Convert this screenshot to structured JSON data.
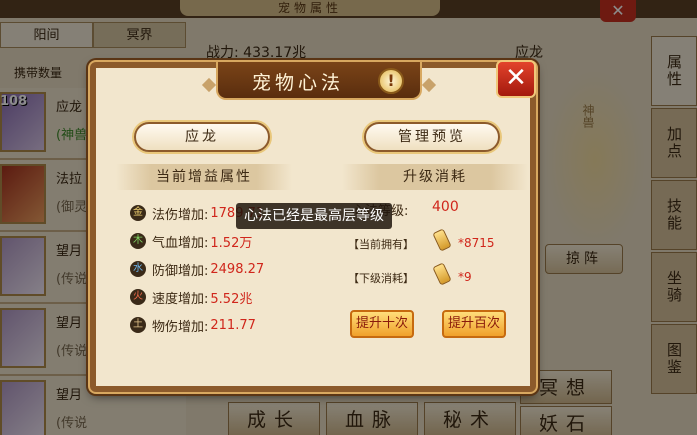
{
  "background": {
    "panel_title": "宠物属性",
    "tabs": [
      "阳间",
      "冥界"
    ],
    "carry_label": "携带数量",
    "pets": [
      {
        "level": "108",
        "name": "应龙",
        "sub": "(神兽"
      },
      {
        "level": "",
        "name": "法拉",
        "sub": "(御灵"
      },
      {
        "level": "",
        "name": "望月",
        "sub": "(传说"
      },
      {
        "level": "",
        "name": "望月",
        "sub": "(传说"
      },
      {
        "level": "",
        "name": "望月",
        "sub": "(传说"
      }
    ],
    "power_label": "战力:",
    "power_value": "433.17兆",
    "pet_name": "应龙",
    "hero_label": "神兽",
    "side_tabs": [
      "属性",
      "加点",
      "技能",
      "坐骑",
      "图鉴"
    ],
    "lineup_button": "掠阵",
    "bottom_buttons": [
      "成长",
      "血脉",
      "秘术",
      "冥想",
      "妖石"
    ]
  },
  "dialog": {
    "title": "宠物心法",
    "info_icon": "!",
    "close_icon": "✕",
    "pet_button": "应龙",
    "manage_button": "管理预览",
    "left_section": "当前增益属性",
    "right_section": "升级消耗",
    "attributes": [
      {
        "element": "金",
        "label": "法伤增加:",
        "value": "1789.71"
      },
      {
        "element": "木",
        "label": "气血增加:",
        "value": "1.52万"
      },
      {
        "element": "水",
        "label": "防御增加:",
        "value": "2498.27"
      },
      {
        "element": "火",
        "label": "速度增加:",
        "value": "5.52兆"
      },
      {
        "element": "土",
        "label": "物伤增加:",
        "value": "211.77"
      }
    ],
    "level_label": "心法等级:",
    "level_value": "400",
    "owned_label": "【当前拥有】",
    "owned_value": "*8715",
    "next_cost_label": "【下级消耗】",
    "next_cost_value": "*9",
    "upgrade_ten": "提升十次",
    "upgrade_hundred": "提升百次"
  },
  "toast": "心法已经是最高层等级"
}
